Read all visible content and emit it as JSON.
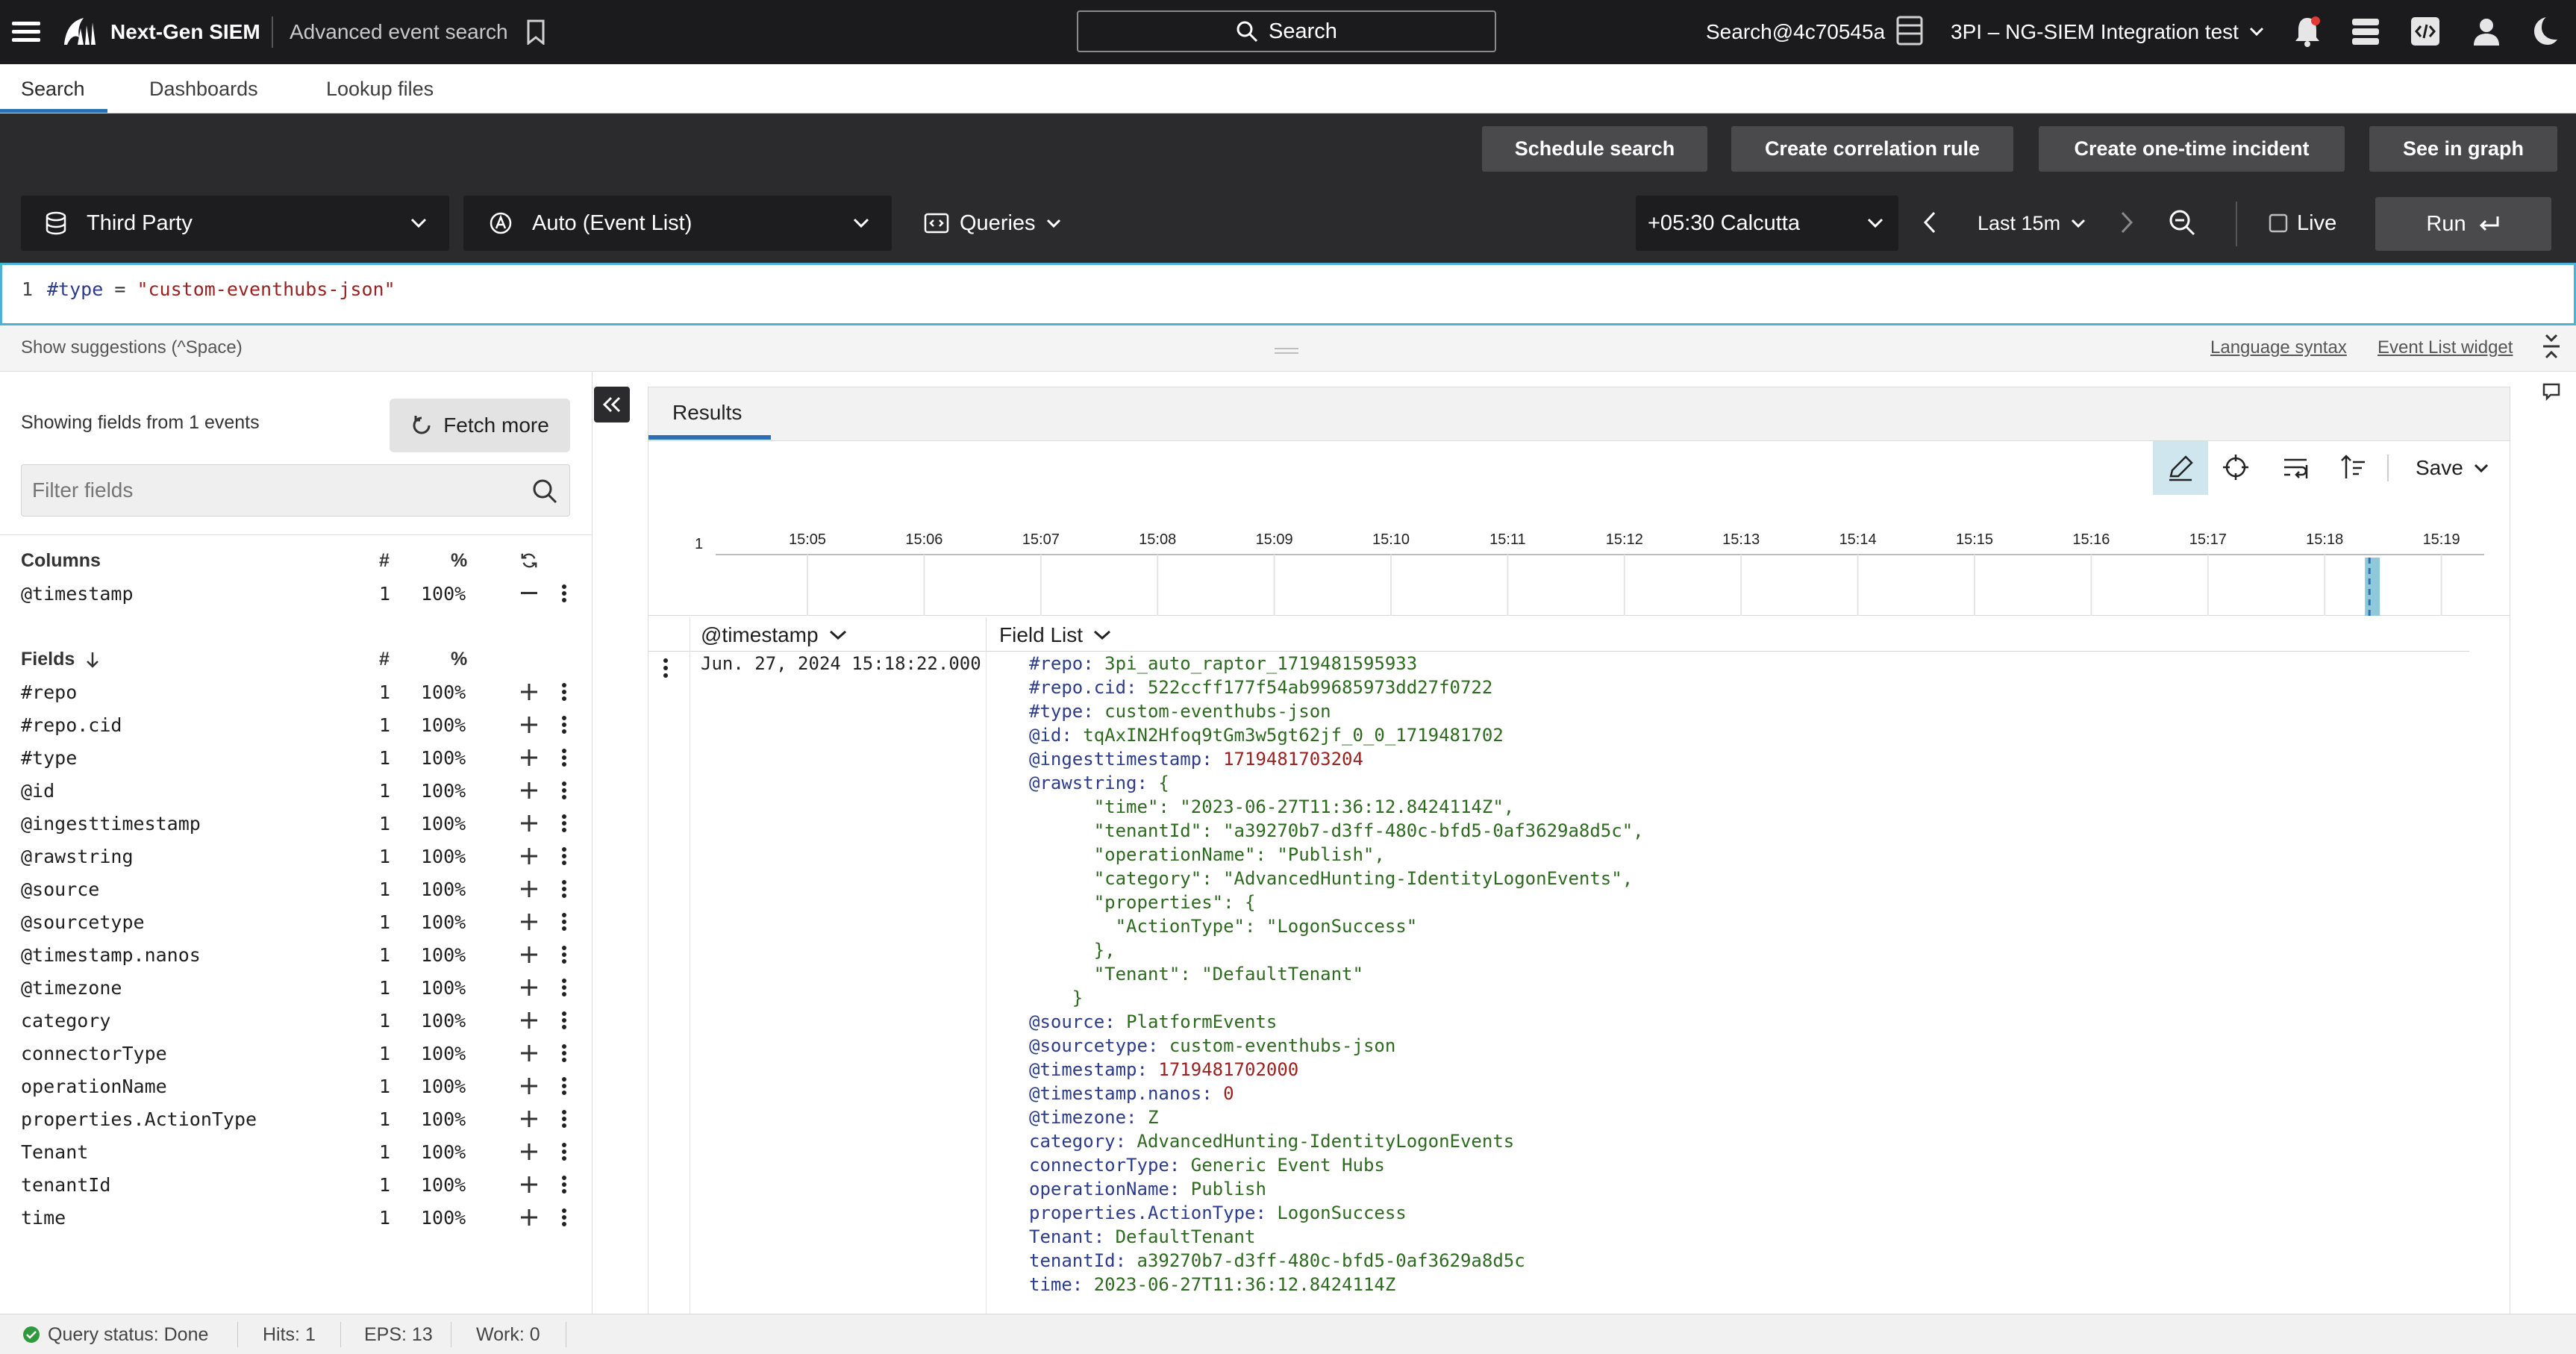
{
  "topbar": {
    "app_name": "Next-Gen SIEM",
    "page_title": "Advanced event search",
    "search_label": "Search",
    "user_label": "Search@4c70545a",
    "tenant_label": "3PI – NG-SIEM Integration test"
  },
  "tabs": [
    {
      "label": "Search",
      "active": true
    },
    {
      "label": "Dashboards",
      "active": false
    },
    {
      "label": "Lookup files",
      "active": false
    }
  ],
  "actions": {
    "schedule": "Schedule search",
    "correlation": "Create correlation rule",
    "incident": "Create one-time incident",
    "graph": "See in graph"
  },
  "toolbar": {
    "repository": "Third Party",
    "view_mode": "Auto (Event List)",
    "queries": "Queries",
    "timezone": "+05:30 Calcutta",
    "time_range": "Last 15m",
    "live_label": "Live",
    "run_label": "Run"
  },
  "query": {
    "line_no": "1",
    "field": "#type",
    "op": "=",
    "value": "\"custom-eventhubs-json\""
  },
  "suggest": {
    "hint": "Show suggestions (^Space)",
    "language_syntax": "Language syntax",
    "event_list_widget": "Event List widget"
  },
  "fields_panel": {
    "summary": "Showing fields from 1 events",
    "fetch_more": "Fetch more",
    "filter_placeholder": "Filter fields",
    "columns_header": {
      "name": "Columns",
      "count": "#",
      "pct": "%"
    },
    "columns": [
      {
        "name": "@timestamp",
        "count": "1",
        "pct": "100%"
      }
    ],
    "fields_header": {
      "name": "Fields",
      "count": "#",
      "pct": "%"
    },
    "fields": [
      {
        "name": "#repo",
        "count": "1",
        "pct": "100%"
      },
      {
        "name": "#repo.cid",
        "count": "1",
        "pct": "100%"
      },
      {
        "name": "#type",
        "count": "1",
        "pct": "100%"
      },
      {
        "name": "@id",
        "count": "1",
        "pct": "100%"
      },
      {
        "name": "@ingesttimestamp",
        "count": "1",
        "pct": "100%"
      },
      {
        "name": "@rawstring",
        "count": "1",
        "pct": "100%"
      },
      {
        "name": "@source",
        "count": "1",
        "pct": "100%"
      },
      {
        "name": "@sourcetype",
        "count": "1",
        "pct": "100%"
      },
      {
        "name": "@timestamp.nanos",
        "count": "1",
        "pct": "100%"
      },
      {
        "name": "@timezone",
        "count": "1",
        "pct": "100%"
      },
      {
        "name": "category",
        "count": "1",
        "pct": "100%"
      },
      {
        "name": "connectorType",
        "count": "1",
        "pct": "100%"
      },
      {
        "name": "operationName",
        "count": "1",
        "pct": "100%"
      },
      {
        "name": "properties.ActionType",
        "count": "1",
        "pct": "100%"
      },
      {
        "name": "Tenant",
        "count": "1",
        "pct": "100%"
      },
      {
        "name": "tenantId",
        "count": "1",
        "pct": "100%"
      },
      {
        "name": "time",
        "count": "1",
        "pct": "100%"
      }
    ]
  },
  "results": {
    "tab_label": "Results",
    "save_label": "Save",
    "timeline": {
      "y_max": "1",
      "ticks": [
        "15:05",
        "15:06",
        "15:07",
        "15:08",
        "15:09",
        "15:10",
        "15:11",
        "15:12",
        "15:13",
        "15:14",
        "15:15",
        "15:16",
        "15:17",
        "15:18",
        "15:19"
      ],
      "bar_value": 1
    },
    "col_timestamp": "@timestamp",
    "col_fieldlist": "Field List",
    "event": {
      "timestamp": "Jun. 27, 2024 15:18:22.000",
      "lines": [
        {
          "k": "#repo",
          "v": "3pi_auto_raptor_1719481595933",
          "cls": "v"
        },
        {
          "k": "#repo.cid",
          "v": "522ccff177f54ab99685973dd27f0722",
          "cls": "v"
        },
        {
          "k": "#type",
          "v": "custom-eventhubs-json",
          "cls": "v"
        },
        {
          "k": "@id",
          "v": "tqAxIN2Hfoq9tGm3w5gt62jf_0_0_1719481702",
          "cls": "v"
        },
        {
          "k": "@ingesttimestamp",
          "v": "1719481703204",
          "cls": "vr"
        },
        {
          "k": "@rawstring",
          "v": "{",
          "cls": "v"
        }
      ],
      "raw_lines": [
        "      \"time\": \"2023-06-27T11:36:12.8424114Z\",",
        "      \"tenantId\": \"a39270b7-d3ff-480c-bfd5-0af3629a8d5c\",",
        "      \"operationName\": \"Publish\",",
        "      \"category\": \"AdvancedHunting-IdentityLogonEvents\",",
        "      \"properties\": {",
        "        \"ActionType\": \"LogonSuccess\"",
        "      },",
        "      \"Tenant\": \"DefaultTenant\"",
        "    }"
      ],
      "tail": [
        {
          "k": "@source",
          "v": "PlatformEvents",
          "cls": "v"
        },
        {
          "k": "@sourcetype",
          "v": "custom-eventhubs-json",
          "cls": "v"
        },
        {
          "k": "@timestamp",
          "v": "1719481702000",
          "cls": "vr"
        },
        {
          "k": "@timestamp.nanos",
          "v": "0",
          "cls": "vr"
        },
        {
          "k": "@timezone",
          "v": "Z",
          "cls": "v"
        },
        {
          "k": "category",
          "v": "AdvancedHunting-IdentityLogonEvents",
          "cls": "v"
        },
        {
          "k": "connectorType",
          "v": "Generic Event Hubs",
          "cls": "v"
        },
        {
          "k": "operationName",
          "v": "Publish",
          "cls": "v"
        },
        {
          "k": "properties.ActionType",
          "v": "LogonSuccess",
          "cls": "v"
        },
        {
          "k": "Tenant",
          "v": "DefaultTenant",
          "cls": "v"
        },
        {
          "k": "tenantId",
          "v": "a39270b7-d3ff-480c-bfd5-0af3629a8d5c",
          "cls": "v"
        },
        {
          "k": "time",
          "v": "2023-06-27T11:36:12.8424114Z",
          "cls": "v"
        }
      ]
    }
  },
  "status": {
    "query_status": "Query status: Done",
    "hits": "Hits: 1",
    "eps": "EPS: 13",
    "work": "Work: 0"
  },
  "colors": {
    "accent": "#2b6fb5",
    "editor_border": "#4ab3d4",
    "topbar_bg": "#1b1b1d",
    "toolbar_bg": "#2b2b2d",
    "status_ok": "#2e9a3e"
  }
}
